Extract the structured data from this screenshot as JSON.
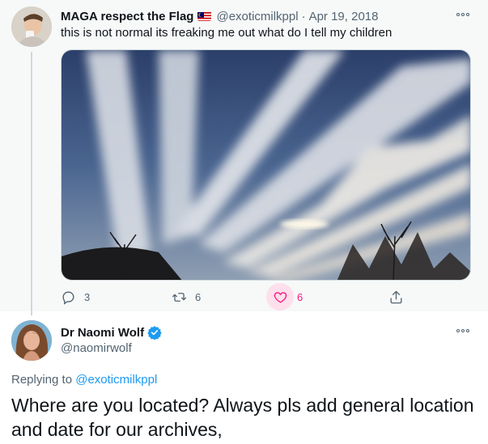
{
  "parent_tweet": {
    "author_name": "MAGA respect the Flag",
    "flag_emoji": "malaysia-flag",
    "handle": "@exoticmilkppl",
    "separator": "·",
    "date": "Apr 19, 2018",
    "text": "this is not normal its freaking me out what do I tell my children",
    "image_description_icon": "sky-streaks-photo",
    "actions": {
      "reply_count": "3",
      "retweet_count": "6",
      "like_count": "6",
      "like_active": true
    }
  },
  "reply_tweet": {
    "author_name": "Dr Naomi Wolf",
    "verified": true,
    "handle": "@naomirwolf",
    "replying_prefix": "Replying to",
    "replying_to": "@exoticmilkppl",
    "text": "Where are you located? Always pls add general location and date for our archives,"
  },
  "colors": {
    "accent": "#1d9bf0",
    "like": "#f91880",
    "muted": "#536471",
    "text": "#0f1419"
  }
}
